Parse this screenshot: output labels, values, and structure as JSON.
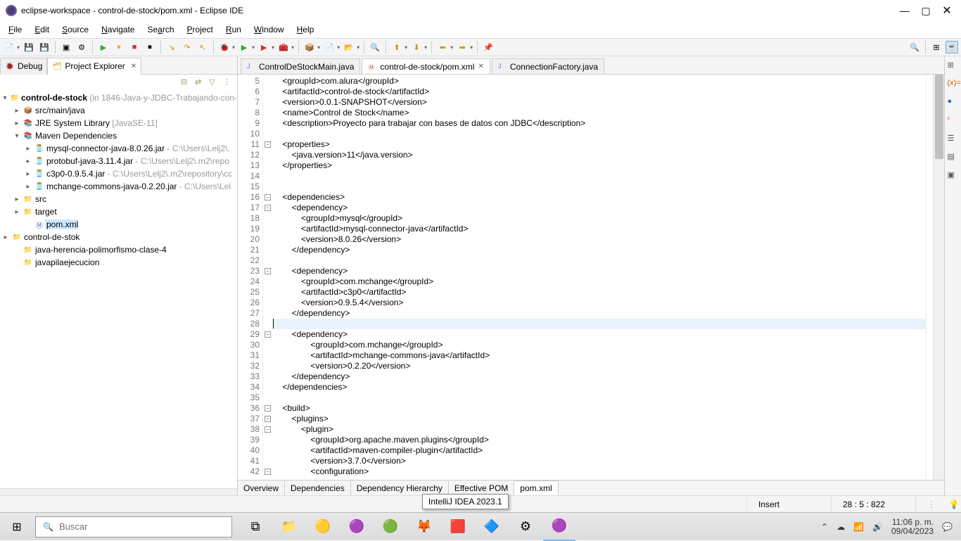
{
  "window": {
    "title": "eclipse-workspace - control-de-stock/pom.xml - Eclipse IDE"
  },
  "menu": [
    "File",
    "Edit",
    "Source",
    "Navigate",
    "Search",
    "Project",
    "Run",
    "Window",
    "Help"
  ],
  "leftTabs": {
    "debug": "Debug",
    "explorer": "Project Explorer"
  },
  "tree": {
    "root": {
      "label": "control-de-stock",
      "extra": " (in 1846-Java-y-JDBC-Trabajando-con-"
    },
    "srcMainJava": "src/main/java",
    "jre": {
      "label": "JRE System Library",
      "extra": " [JavaSE-11]"
    },
    "maven": "Maven Dependencies",
    "jar1": {
      "label": "mysql-connector-java-8.0.26.jar",
      "path": " - C:\\Users\\Lelj2\\."
    },
    "jar2": {
      "label": "protobuf-java-3.11.4.jar",
      "path": " - C:\\Users\\Lelj2\\.m2\\repo"
    },
    "jar3": {
      "label": "c3p0-0.9.5.4.jar",
      "path": " - C:\\Users\\Lelj2\\.m2\\repository\\cc"
    },
    "jar4": {
      "label": "mchange-commons-java-0.2.20.jar",
      "path": " - C:\\Users\\Lel"
    },
    "src": "src",
    "target": "target",
    "pom": "pom.xml",
    "proj2": "control-de-stok",
    "proj3": "java-herencia-polimorfismo-clase-4",
    "proj4": "javapilaejecucion"
  },
  "editorTabs": {
    "t1": "ControlDeStockMain.java",
    "t2": "control-de-stock/pom.xml",
    "t3": "ConnectionFactory.java"
  },
  "chart_data": {
    "type": "table",
    "title": "pom.xml code lines",
    "lines": [
      {
        "n": 5,
        "t": "    <groupId>com.alura</groupId>"
      },
      {
        "n": 6,
        "t": "    <artifactId>control-de-stock</artifactId>"
      },
      {
        "n": 7,
        "t": "    <version>0.0.1-SNAPSHOT</version>"
      },
      {
        "n": 8,
        "t": "    <name>Control de Stock</name>"
      },
      {
        "n": 9,
        "t": "    <description>Proyecto para trabajar con bases de datos con JDBC</description>"
      },
      {
        "n": 10,
        "t": ""
      },
      {
        "n": 11,
        "t": "    <properties>",
        "fold": "-"
      },
      {
        "n": 12,
        "t": "        <java.version>11</java.version>"
      },
      {
        "n": 13,
        "t": "    </properties>"
      },
      {
        "n": 14,
        "t": ""
      },
      {
        "n": 15,
        "t": ""
      },
      {
        "n": 16,
        "t": "    <dependencies>",
        "fold": "-"
      },
      {
        "n": 17,
        "t": "        <dependency>",
        "fold": "-"
      },
      {
        "n": 18,
        "t": "            <groupId>mysql</groupId>"
      },
      {
        "n": 19,
        "t": "            <artifactId>mysql-connector-java</artifactId>"
      },
      {
        "n": 20,
        "t": "            <version>8.0.26</version>"
      },
      {
        "n": 21,
        "t": "        </dependency>"
      },
      {
        "n": 22,
        "t": ""
      },
      {
        "n": 23,
        "t": "        <dependency>",
        "fold": "-"
      },
      {
        "n": 24,
        "t": "            <groupId>com.mchange</groupId>"
      },
      {
        "n": 25,
        "t": "            <artifactId>c3p0</artifactId>"
      },
      {
        "n": 26,
        "t": "            <version>0.9.5.4</version>"
      },
      {
        "n": 27,
        "t": "        </dependency>"
      },
      {
        "n": 28,
        "t": "        ",
        "hl": true
      },
      {
        "n": 29,
        "t": "        <dependency>",
        "fold": "-"
      },
      {
        "n": 30,
        "t": "                <groupId>com.mchange</groupId>"
      },
      {
        "n": 31,
        "t": "                <artifactId>mchange-commons-java</artifactId>"
      },
      {
        "n": 32,
        "t": "                <version>0.2.20</version>"
      },
      {
        "n": 33,
        "t": "        </dependency>"
      },
      {
        "n": 34,
        "t": "    </dependencies>"
      },
      {
        "n": 35,
        "t": ""
      },
      {
        "n": 36,
        "t": "    <build>",
        "fold": "-"
      },
      {
        "n": 37,
        "t": "        <plugins>",
        "fold": "-"
      },
      {
        "n": 38,
        "t": "            <plugin>",
        "fold": "-"
      },
      {
        "n": 39,
        "t": "                <groupId>org.apache.maven.plugins</groupId>"
      },
      {
        "n": 40,
        "t": "                <artifactId>maven-compiler-plugin</artifactId>"
      },
      {
        "n": 41,
        "t": "                <version>3.7.0</version>"
      },
      {
        "n": 42,
        "t": "                <configuration>",
        "fold": "-"
      }
    ]
  },
  "bottomTabs": [
    "Overview",
    "Dependencies",
    "Dependency Hierarchy",
    "Effective POM",
    "pom.xml"
  ],
  "status": {
    "insert": "Insert",
    "pos": "28 : 5 : 822"
  },
  "tooltip": "IntelliJ IDEA 2023.1",
  "taskbar": {
    "searchPlaceholder": "Buscar",
    "time": "11:06 p. m.",
    "date": "09/04/2023"
  }
}
